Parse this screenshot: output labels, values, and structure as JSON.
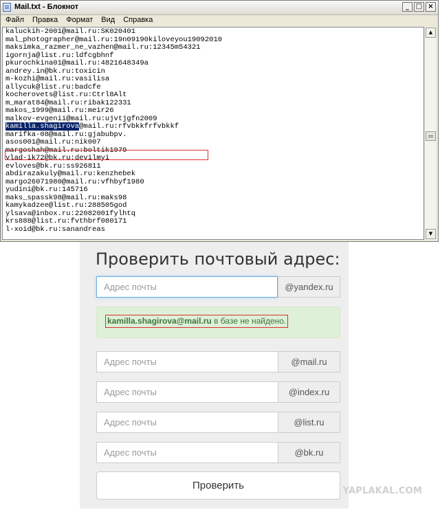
{
  "notepad": {
    "title": "Mail.txt - Блокнот",
    "controls": {
      "minimize": "_",
      "maximize": "□",
      "close": "×"
    },
    "menu": [
      "Файл",
      "Правка",
      "Формат",
      "Вид",
      "Справка"
    ],
    "lines": [
      "kaluckih-2001@mail.ru:SK020401",
      "mal_photographer@mail.ru:19n09190kiloveyou19092010",
      "maksimka_razmer_ne_vazhen@mail.ru:12345m54321",
      "igornja@list.ru:ldfcgbhnf",
      "pkurochkina01@mail.ru:4821648349a",
      "andrey.in@bk.ru:toxicin",
      "m-kozhi@mail.ru:vasilisa",
      "allycuk@list.ru:badcfe",
      "kocherovets@list.ru:Ctrl8Alt",
      "m_marat84@mail.ru:ribak122331",
      "makos_1999@mail.ru:meir26",
      "malkov-evgenii@mail.ru:ujvtjgfn2009",
      "",
      "marifka-08@mail.ru:gjabubpv.",
      "asos001@mail.ru:nik007",
      "margoshah@mail.ru:boltik1979",
      "vlad-ik72@bk.ru:devilmyi",
      "evloves@bk.ru:ss926811",
      "abdirazakuly@mail.ru:kenzhebek",
      "margo26071980@mail.ru:vfhbyf1980",
      "yudini@bk.ru:145716",
      "maks_spassk98@mail.ru:maks98",
      "kamykadzee@list.ru:288505god",
      "ylsava@inbox.ru:22082001fylhtq",
      "krs888@list.ru:fvthbrf080171",
      "l-xoid@bk.ru:sanandreas"
    ],
    "selected_line": {
      "highlight": "kamilla.shagirova",
      "rest": "@mail.ru:rfvbkkfrfvbkkf"
    },
    "scroll": {
      "up": "▲",
      "down": "▼"
    }
  },
  "checker": {
    "title": "Проверить почтовый адрес:",
    "fields": [
      {
        "placeholder": "Адрес почты",
        "domain": "@yandex.ru"
      },
      {
        "placeholder": "Адрес почты",
        "domain": "@mail.ru"
      },
      {
        "placeholder": "Адрес почты",
        "domain": "@index.ru"
      },
      {
        "placeholder": "Адрес почты",
        "domain": "@list.ru"
      },
      {
        "placeholder": "Адрес почты",
        "domain": "@bk.ru"
      }
    ],
    "result": {
      "email": "kamilla.shagirova@mail.ru",
      "message": " в базе не найдено."
    },
    "submit_label": "Проверить"
  },
  "watermark": "YAPLAKAL.COM",
  "colors": {
    "selection": "#0a246a",
    "annotation_red": "#d83030",
    "alert_bg": "#dff0d8",
    "alert_text": "#3c763d",
    "focus_border": "#66afe9"
  }
}
